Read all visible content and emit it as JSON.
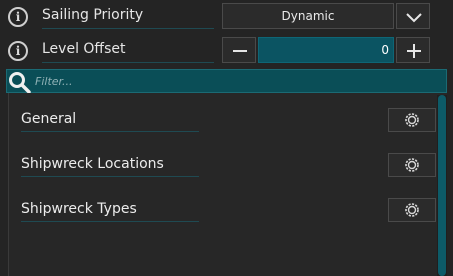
{
  "settings": {
    "sailing_priority": {
      "label": "Sailing Priority",
      "value": "Dynamic"
    },
    "level_offset": {
      "label": "Level Offset",
      "value": "0",
      "decrement_symbol": "−",
      "increment_symbol": "+"
    }
  },
  "filter": {
    "placeholder": "Filter...",
    "value": ""
  },
  "sections": [
    {
      "label": "General"
    },
    {
      "label": "Shipwreck Locations"
    },
    {
      "label": "Shipwreck Types"
    }
  ],
  "icons": {
    "info": "info-icon",
    "dropdown": "chevron-down-icon",
    "search": "search-icon",
    "settings": "gear-icon"
  },
  "colors": {
    "background": "#242424",
    "accent": "#0b5462",
    "scroll_thumb": "#0d5b68"
  }
}
